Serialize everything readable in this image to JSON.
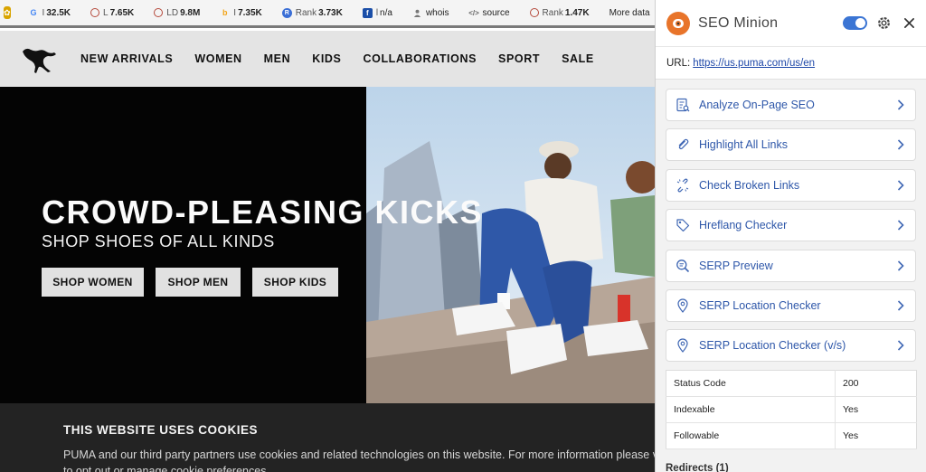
{
  "toolbar": {
    "metrics": [
      {
        "icon": "google-icon",
        "glyph": "G",
        "prefix": "I",
        "value": "32.5K"
      },
      {
        "icon": "ahrefs-l-icon",
        "glyph": "",
        "prefix": "L",
        "value": "7.65K"
      },
      {
        "icon": "ahrefs-ld-icon",
        "glyph": "",
        "prefix": "LD",
        "value": "9.8M"
      },
      {
        "icon": "bing-icon",
        "glyph": "b",
        "prefix": "I",
        "value": "7.35K"
      },
      {
        "icon": "rank-icon",
        "glyph": "R",
        "prefix": "Rank",
        "value": "3.73K"
      },
      {
        "icon": "facebook-icon",
        "glyph": "f",
        "prefix": "l",
        "value": "n/a"
      },
      {
        "icon": "whois-icon",
        "glyph": "👤",
        "prefix": "",
        "value": "whois"
      },
      {
        "icon": "source-icon",
        "glyph": "</>",
        "prefix": "",
        "value": "source"
      },
      {
        "icon": "alexa-rank-icon",
        "glyph": "",
        "prefix": "Rank",
        "value": "1.47K"
      },
      {
        "icon": "",
        "glyph": "",
        "prefix": "",
        "value": "More data"
      }
    ]
  },
  "site": {
    "nav": [
      "NEW ARRIVALS",
      "WOMEN",
      "MEN",
      "KIDS",
      "COLLABORATIONS",
      "SPORT",
      "SALE"
    ],
    "hero": {
      "title": "CROWD-PLEASING KICKS",
      "subtitle": "SHOP SHOES OF ALL KINDS",
      "buttons": [
        "SHOP WOMEN",
        "SHOP MEN",
        "SHOP KIDS"
      ]
    },
    "cookie": {
      "title": "THIS WEBSITE USES COOKIES",
      "line1": "PUMA and our third party partners use cookies and related technologies on this website. For more information please visit",
      "line2": "to opt out or manage cookie preferences."
    }
  },
  "panel": {
    "title": "SEO Minion",
    "url_label": "URL:",
    "url": "https://us.puma.com/us/en",
    "tools": [
      {
        "icon": "analyze-page-icon",
        "label": "Analyze On-Page SEO"
      },
      {
        "icon": "paperclip-icon",
        "label": "Highlight All Links"
      },
      {
        "icon": "broken-link-icon",
        "label": "Check Broken Links"
      },
      {
        "icon": "tag-icon",
        "label": "Hreflang Checker"
      },
      {
        "icon": "magnifier-icon",
        "label": "SERP Preview"
      },
      {
        "icon": "location-pin-icon",
        "label": "SERP Location Checker"
      },
      {
        "icon": "location-pin-icon",
        "label": "SERP Location Checker (v/s)"
      }
    ],
    "info": [
      {
        "key": "Status Code",
        "value": "200"
      },
      {
        "key": "Indexable",
        "value": "Yes"
      },
      {
        "key": "Followable",
        "value": "Yes"
      }
    ],
    "redirects_label": "Redirects (1)"
  },
  "colors": {
    "panel_link": "#2e57a9",
    "toggle_on": "#3b75d4",
    "minion_orange": "#e8742a",
    "hero_bg": "#040404",
    "cookie_bg": "#232323"
  }
}
